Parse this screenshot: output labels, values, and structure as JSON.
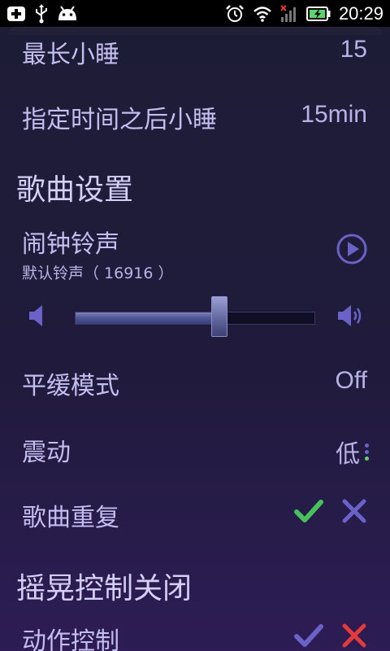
{
  "status_bar": {
    "time": "20:29",
    "left_icons": [
      "add-box-icon",
      "usb-icon",
      "android-icon"
    ],
    "right_icons": [
      "alarm-clock-icon",
      "wifi-icon",
      "signal-icon",
      "battery-charging-icon"
    ]
  },
  "settings": {
    "max_snooze": {
      "label": "最长小睡",
      "value": "15"
    },
    "snooze_after": {
      "label": "指定时间之后小睡",
      "value": "15min"
    },
    "song_section_title": "歌曲设置",
    "alarm_ringtone": {
      "label": "闹钟铃声",
      "subtitle": "默认铃声（ 16916 ）"
    },
    "volume": {
      "level": 0.6
    },
    "gentle_mode": {
      "label": "平缓模式",
      "value": "Off"
    },
    "vibration": {
      "label": "震动",
      "value": "低"
    },
    "song_repeat": {
      "label": "歌曲重复",
      "selected": "yes"
    },
    "shake_section_title": "摇晃控制关闭",
    "motion_control": {
      "label": "动作控制",
      "selected": "no"
    }
  },
  "colors": {
    "accent_purple": "#6b62c9",
    "check_green": "#47c25a",
    "cross_red": "#e43a3a"
  }
}
